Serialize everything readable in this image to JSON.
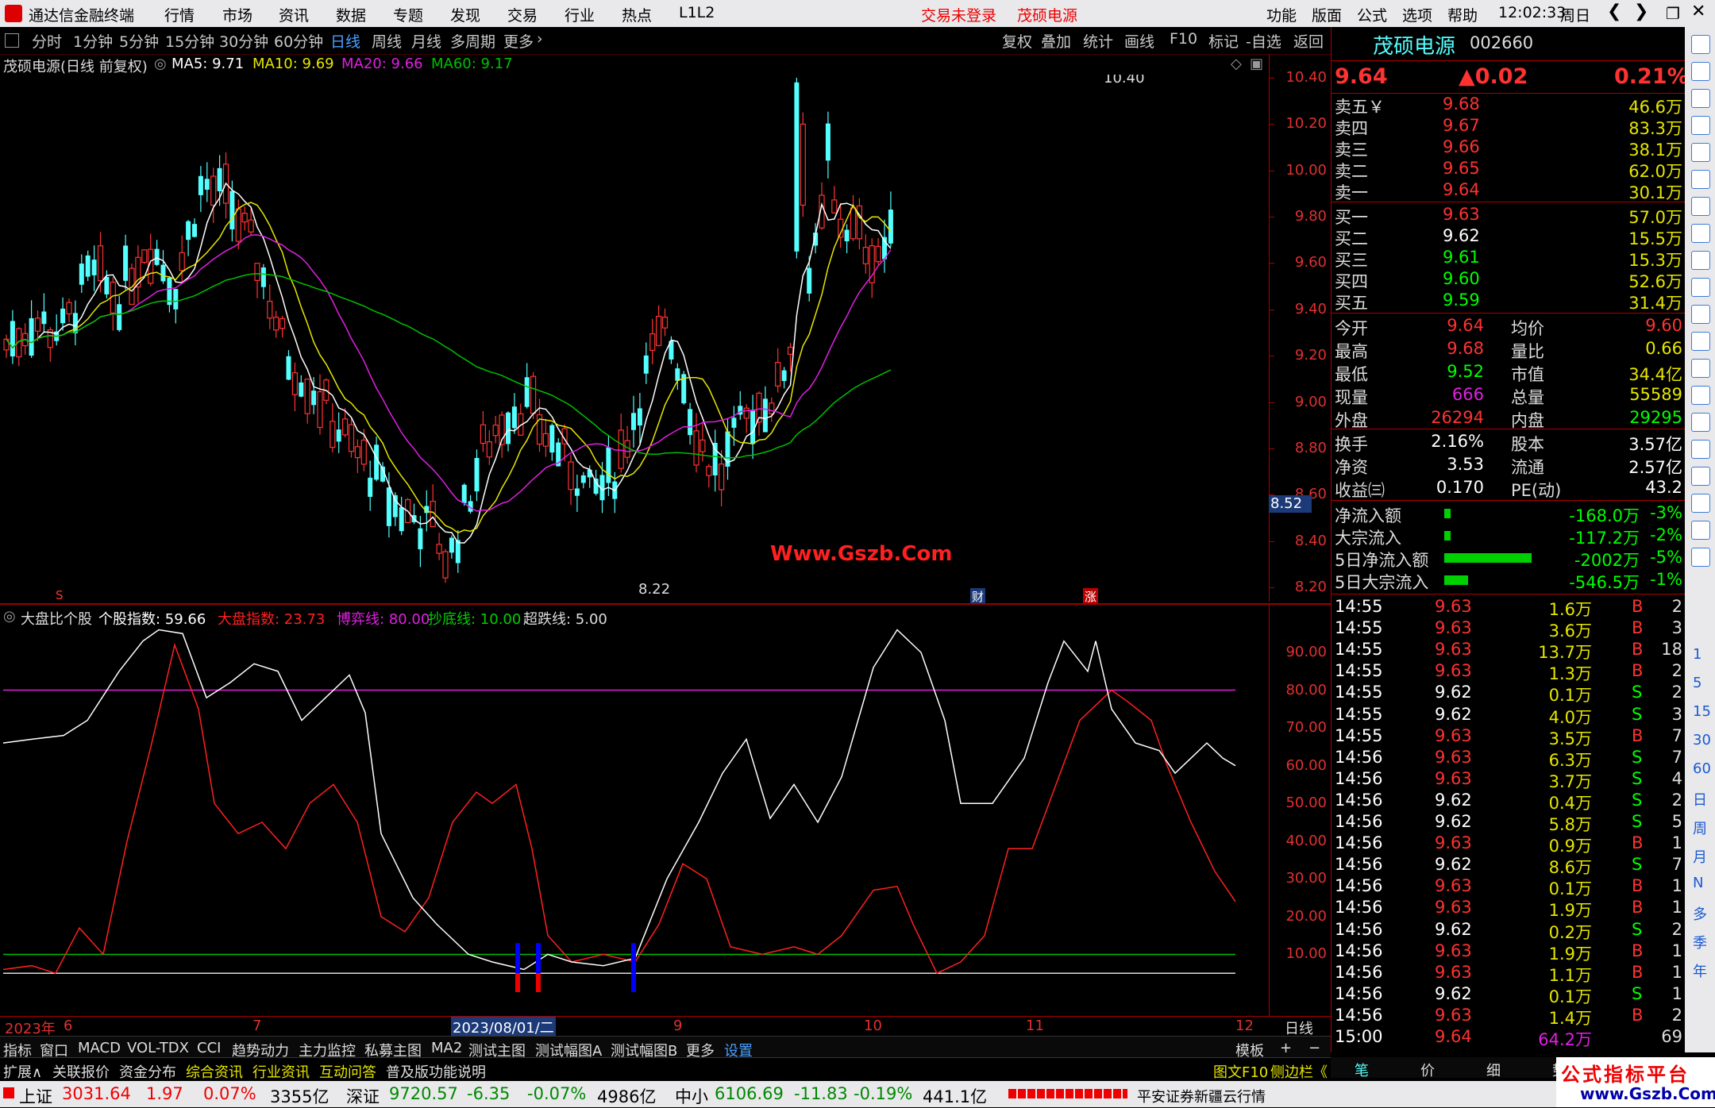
{
  "window": {
    "app_title": "通达信金融终端",
    "menus": [
      "行情",
      "市场",
      "资讯",
      "数据",
      "专题",
      "发现",
      "交易",
      "行业",
      "热点",
      "L1L2"
    ],
    "notice_trade": "交易未登录",
    "notice_stock": "茂硕电源",
    "right_menus": [
      "功能",
      "版面",
      "公式",
      "选项",
      "帮助"
    ],
    "clock": "12:02:33",
    "weekday": "周日"
  },
  "toolbar": {
    "periods": [
      "分时",
      "1分钟",
      "5分钟",
      "15分钟",
      "30分钟",
      "60分钟",
      "日线",
      "周线",
      "月线",
      "多周期",
      "更多"
    ],
    "active_period": "日线",
    "right_buttons": [
      "复权",
      "叠加",
      "统计",
      "画线",
      "F10",
      "标记",
      "-自选",
      "返回"
    ]
  },
  "main_chart": {
    "title": "茂硕电源(日线 前复权)",
    "ma5": "MA5: 9.71",
    "ma10": "MA10: 9.69",
    "ma20": "MA20: 9.66",
    "ma60": "MA60: 9.17",
    "y_ticks": [
      "10.40",
      "10.20",
      "10.00",
      "9.80",
      "9.60",
      "9.40",
      "9.20",
      "9.00",
      "8.80",
      "8.60",
      "8.40",
      "8.20"
    ],
    "current_price_tag": "8.52",
    "high_label": "10.40",
    "low_label": "8.22",
    "watermark": "Www.Gszb.Com",
    "markers": {
      "cai": "财",
      "zhang": "涨",
      "s": "S"
    }
  },
  "sub_chart": {
    "title": "大盘比个股",
    "geguzhi": "个股指数: 59.66",
    "dapan": "大盘指数: 23.73",
    "boyi": "博弈线: 80.00",
    "chaodi": "抄底线: 10.00",
    "chaodie": "超跌线: 5.00",
    "y_ticks": [
      "90.00",
      "80.00",
      "70.00",
      "60.00",
      "50.00",
      "40.00",
      "30.00",
      "20.00",
      "10.00"
    ]
  },
  "time_axis": {
    "labels": [
      "2023年",
      "6",
      "7",
      "2023/08/01/二",
      "9",
      "10",
      "11",
      "12"
    ],
    "period_label": "日线"
  },
  "bottom_tabs": [
    "指标",
    "窗口",
    "MACD",
    "VOL-TDX",
    "CCI",
    "趋势动力",
    "主力监控",
    "私募主图",
    "MA2",
    "测试主图",
    "测试幅图A",
    "测试幅图B",
    "更多",
    "设置"
  ],
  "bottom_tabs_right": [
    "模板",
    "+",
    "−"
  ],
  "bottom_tabs2": [
    "扩展∧",
    "关联报价",
    "资金分布",
    "综合资讯",
    "行业资讯",
    "互动问答",
    "普及版功能说明"
  ],
  "bottom_tabs2_right": [
    "图文F10",
    "侧边栏《"
  ],
  "right_bottom_tabs": [
    "笔",
    "价",
    "细",
    "势",
    "联"
  ],
  "quote": {
    "name": "茂硕电源",
    "code": "002660",
    "price": "9.64",
    "change": "▲0.02",
    "pct": "0.21%",
    "asks": [
      {
        "label": "卖五￥",
        "price": "9.68",
        "vol": "46.6万"
      },
      {
        "label": "卖四",
        "price": "9.67",
        "vol": "83.3万"
      },
      {
        "label": "卖三",
        "price": "9.66",
        "vol": "38.1万"
      },
      {
        "label": "卖二",
        "price": "9.65",
        "vol": "62.0万"
      },
      {
        "label": "卖一",
        "price": "9.64",
        "vol": "30.1万"
      }
    ],
    "bids": [
      {
        "label": "买一",
        "price": "9.63",
        "vol": "57.0万"
      },
      {
        "label": "买二",
        "price": "9.62",
        "vol": "15.5万"
      },
      {
        "label": "买三",
        "price": "9.61",
        "vol": "15.3万"
      },
      {
        "label": "买四",
        "price": "9.60",
        "vol": "52.6万"
      },
      {
        "label": "买五",
        "price": "9.59",
        "vol": "31.4万"
      }
    ],
    "stats": [
      {
        "l1": "今开",
        "v1": "9.64",
        "l2": "均价",
        "v2": "9.60"
      },
      {
        "l1": "最高",
        "v1": "9.68",
        "l2": "量比",
        "v2": "0.66"
      },
      {
        "l1": "最低",
        "v1": "9.52",
        "l2": "市值",
        "v2": "34.4亿"
      },
      {
        "l1": "现量",
        "v1": "666",
        "l2": "总量",
        "v2": "55589"
      },
      {
        "l1": "外盘",
        "v1": "26294",
        "l2": "内盘",
        "v2": "29295"
      }
    ],
    "stats2": [
      {
        "l1": "换手",
        "v1": "2.16%",
        "l2": "股本",
        "v2": "3.57亿"
      },
      {
        "l1": "净资",
        "v1": "3.53",
        "l2": "流通",
        "v2": "2.57亿"
      },
      {
        "l1": "收益㈢",
        "v1": "0.170",
        "l2": "PE(动)",
        "v2": "43.2"
      }
    ],
    "flows": [
      {
        "label": "净流入额",
        "value": "-168.0万",
        "pct": "-3%",
        "bar": 0.03
      },
      {
        "label": "大宗流入",
        "value": "-117.2万",
        "pct": "-2%",
        "bar": 0.02
      },
      {
        "label": "5日净流入额",
        "value": "-2002万",
        "pct": "-5%",
        "bar": 0.55
      },
      {
        "label": "5日大宗流入",
        "value": "-546.5万",
        "pct": "-1%",
        "bar": 0.15
      }
    ],
    "ticks": [
      {
        "t": "14:55",
        "p": "9.63",
        "v": "1.6万",
        "bs": "B",
        "n": "2"
      },
      {
        "t": "14:55",
        "p": "9.63",
        "v": "3.6万",
        "bs": "B",
        "n": "3"
      },
      {
        "t": "14:55",
        "p": "9.63",
        "v": "13.7万",
        "bs": "B",
        "n": "18"
      },
      {
        "t": "14:55",
        "p": "9.63",
        "v": "1.3万",
        "bs": "B",
        "n": "2"
      },
      {
        "t": "14:55",
        "p": "9.62",
        "v": "0.1万",
        "bs": "S",
        "n": "2"
      },
      {
        "t": "14:55",
        "p": "9.62",
        "v": "4.0万",
        "bs": "S",
        "n": "3"
      },
      {
        "t": "14:55",
        "p": "9.63",
        "v": "3.5万",
        "bs": "B",
        "n": "7"
      },
      {
        "t": "14:56",
        "p": "9.63",
        "v": "6.3万",
        "bs": "S",
        "n": "7"
      },
      {
        "t": "14:56",
        "p": "9.63",
        "v": "3.7万",
        "bs": "S",
        "n": "4"
      },
      {
        "t": "14:56",
        "p": "9.62",
        "v": "0.4万",
        "bs": "S",
        "n": "2"
      },
      {
        "t": "14:56",
        "p": "9.62",
        "v": "5.8万",
        "bs": "S",
        "n": "5"
      },
      {
        "t": "14:56",
        "p": "9.63",
        "v": "0.9万",
        "bs": "B",
        "n": "1"
      },
      {
        "t": "14:56",
        "p": "9.62",
        "v": "8.6万",
        "bs": "S",
        "n": "7"
      },
      {
        "t": "14:56",
        "p": "9.63",
        "v": "0.1万",
        "bs": "B",
        "n": "1"
      },
      {
        "t": "14:56",
        "p": "9.63",
        "v": "1.9万",
        "bs": "B",
        "n": "1"
      },
      {
        "t": "14:56",
        "p": "9.62",
        "v": "0.2万",
        "bs": "S",
        "n": "2"
      },
      {
        "t": "14:56",
        "p": "9.63",
        "v": "1.9万",
        "bs": "B",
        "n": "1"
      },
      {
        "t": "14:56",
        "p": "9.63",
        "v": "1.1万",
        "bs": "B",
        "n": "1"
      },
      {
        "t": "14:56",
        "p": "9.62",
        "v": "0.1万",
        "bs": "S",
        "n": "1"
      },
      {
        "t": "14:56",
        "p": "9.63",
        "v": "1.4万",
        "bs": "B",
        "n": "2"
      },
      {
        "t": "15:00",
        "p": "9.64",
        "v": "64.2万",
        "bs": "",
        "n": "69"
      }
    ]
  },
  "status_bar": {
    "sh_label": "上证",
    "sh_val": "3031.64",
    "sh_chg": "1.97",
    "sh_pct": "0.07%",
    "sh_amt": "3355亿",
    "sz_label": "深证",
    "sz_val": "9720.57",
    "sz_chg": "-6.35",
    "sz_pct": "-0.07%",
    "sz_amt": "4986亿",
    "zx_label": "中小",
    "zx_val": "6106.69",
    "zx_chg": "-11.83",
    "zx_pct": "-0.19%",
    "zx_amt": "441.1亿",
    "broker": "平安证券新疆云行情",
    "logo_text": "公式指标平台",
    "logo_url": "www.Gszb.Com"
  },
  "side_icons": [
    "arrow-up",
    "up",
    "down",
    "list",
    "bar",
    "chart",
    "k",
    "info",
    "news",
    "F10",
    "rank",
    "sort",
    "F2",
    "sc",
    "search",
    "money",
    "RSI",
    "alert",
    "move",
    "pen"
  ],
  "side_periods": [
    "1",
    "5",
    "15",
    "30",
    "60",
    "日",
    "周",
    "月",
    "N",
    "多",
    "季",
    "年"
  ],
  "colors": {
    "up": "#ff3232",
    "down": "#54ffff",
    "ma5": "#ffffff",
    "ma10": "#e6e600",
    "ma20": "#e020e0",
    "ma60": "#00c000",
    "accent": "#ff3c3c"
  }
}
